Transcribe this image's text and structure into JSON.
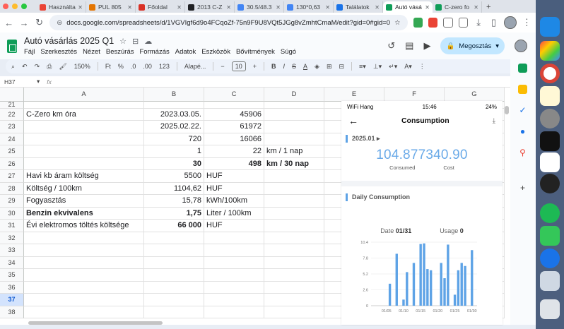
{
  "tabs": [
    {
      "label": "Használta",
      "color": "#ea4335"
    },
    {
      "label": "PUL 805",
      "color": "#e37400"
    },
    {
      "label": "Főoldal",
      "color": "#d93025"
    },
    {
      "label": "2013 C-Z",
      "color": "#202124"
    },
    {
      "label": "30.5/48.3",
      "color": "#4285f4"
    },
    {
      "label": "130*0,63",
      "color": "#4285f4"
    },
    {
      "label": "Találatok",
      "color": "#1a73e8"
    },
    {
      "label": "Autó vásá",
      "color": "#0f9d58",
      "active": true
    },
    {
      "label": "C-zero fo",
      "color": "#0f9d58"
    }
  ],
  "browser": {
    "url": "docs.google.com/spreadsheets/d/1VGVIgf6d9o4FCqoZf-75n9F9U8VQt5JGg8vZmhtCmaM/edit?gid=0#gid=0",
    "back": "←",
    "forward": "→",
    "reload": "↻",
    "newtab": "+"
  },
  "doc": {
    "title": "Autó vásárlás 2025 Q1",
    "menus": [
      "Fájl",
      "Szerkesztés",
      "Nézet",
      "Beszúrás",
      "Formázás",
      "Adatok",
      "Eszközök",
      "Bővítmények",
      "Súgó"
    ],
    "share_label": "Megosztás"
  },
  "toolbar": {
    "zoom": "150%",
    "font": "Alapé...",
    "font_size": "10",
    "items": [
      "Ft",
      "%",
      ".0",
      ".00",
      "123"
    ]
  },
  "formula": {
    "namebox": "H37",
    "fx": "fx"
  },
  "grid": {
    "columns": [
      "A",
      "B",
      "C",
      "D",
      "E",
      "F",
      "G"
    ],
    "rows": [
      "21",
      "22",
      "23",
      "24",
      "25",
      "26",
      "27",
      "28",
      "29",
      "30",
      "31",
      "32",
      "33",
      "34",
      "35",
      "36",
      "37",
      "38"
    ],
    "selected_row": "37",
    "cells": {
      "22": {
        "A": "C-Zero km óra",
        "B": "2023.03.05.",
        "C": "45906"
      },
      "23": {
        "B": "2025.02.22.",
        "C": "61972"
      },
      "24": {
        "B": "720",
        "C": "16066"
      },
      "25": {
        "B": "1",
        "C": "22",
        "D": "km / 1 nap"
      },
      "26": {
        "B": "30",
        "C": "498",
        "D": "km / 30 nap"
      },
      "27": {
        "A": "Havi kb áram költség",
        "B": "5500",
        "C": "HUF"
      },
      "28": {
        "A": "Költség / 100km",
        "B": "1104,62",
        "C": "HUF"
      },
      "29": {
        "A": "Fogyasztás",
        "B": "15,78",
        "C": "kWh/100km"
      },
      "30": {
        "A": "Benzin ekvivalens",
        "B": "1,75",
        "C": "Liter / 100km"
      },
      "31": {
        "A": "Évi elektromos töltés költsége",
        "B": "66 000",
        "C": "HUF"
      }
    }
  },
  "phone": {
    "carrier": "WiFi Hang",
    "time": "15:46",
    "battery": "24%",
    "title": "Consumption",
    "month": "2025.01 ▸",
    "consumed": "104.877",
    "cost": "340.90",
    "consumed_label": "Consumed",
    "cost_label": "Cost",
    "daily_title": "Daily Consumption",
    "date_label": "Date",
    "date_value": "01/31",
    "usage_label": "Usage",
    "usage_value": "0"
  },
  "chart_data": {
    "type": "bar",
    "color": "#5ea3e6",
    "ylim": [
      0,
      10.4
    ],
    "yticks": [
      "10.4",
      "7.8",
      "5.2",
      "2.6",
      "0"
    ],
    "xticks": [
      "01/05",
      "01/10",
      "01/15",
      "01/20",
      "01/25",
      "01/30"
    ],
    "categories": [
      "01/01",
      "01/02",
      "01/03",
      "01/04",
      "01/05",
      "01/06",
      "01/07",
      "01/08",
      "01/09",
      "01/10",
      "01/11",
      "01/12",
      "01/13",
      "01/14",
      "01/15",
      "01/16",
      "01/17",
      "01/18",
      "01/19",
      "01/20",
      "01/21",
      "01/22",
      "01/23",
      "01/24",
      "01/25",
      "01/26",
      "01/27",
      "01/28",
      "01/29",
      "01/30",
      "01/31"
    ],
    "values": [
      0,
      0,
      0,
      0,
      0,
      3.6,
      0,
      8.5,
      0,
      1.0,
      5.5,
      0,
      7.0,
      0,
      10.1,
      10.2,
      6.0,
      5.8,
      0,
      0,
      7.0,
      4.5,
      10.0,
      0,
      1.8,
      5.8,
      7.0,
      6.5,
      0,
      9.1,
      0
    ]
  }
}
